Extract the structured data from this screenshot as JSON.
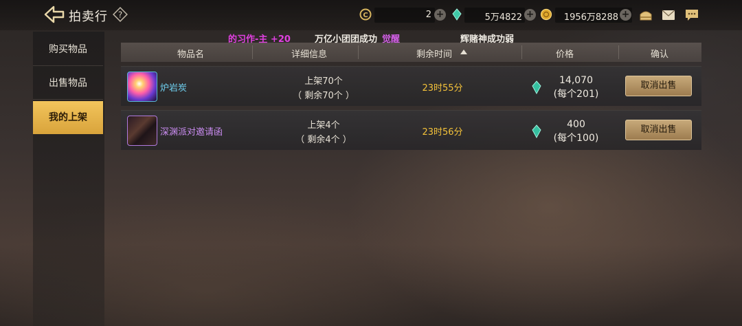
{
  "header": {
    "title": "拍卖行",
    "currencies": [
      {
        "name": "coupon",
        "value": "2"
      },
      {
        "name": "crystal",
        "value": "5万4822"
      },
      {
        "name": "gold",
        "value": "1956万8288"
      }
    ]
  },
  "marquee": {
    "part1": "的习作-主 +20",
    "part2a": "万亿小团团成功",
    "part2b": "觉醒",
    "part3": "辉赌神成功弱"
  },
  "sidebar": {
    "items": [
      {
        "label": "购买物品"
      },
      {
        "label": "出售物品"
      },
      {
        "label": "我的上架"
      }
    ]
  },
  "table": {
    "headers": [
      "物品名",
      "详细信息",
      "剩余时间",
      "价格",
      "确认"
    ],
    "rows": [
      {
        "name": "炉岩炭",
        "listed": "上架70个",
        "remaining": "（ 剩余70个 ）",
        "time": "23时55分",
        "price": "14,070",
        "unit_price": "(每个201)",
        "action": "取消出售"
      },
      {
        "name": "深渊派对邀请函",
        "listed": "上架4个",
        "remaining": "（ 剩余4个 ）",
        "time": "23时56分",
        "price": "400",
        "unit_price": "(每个100)",
        "action": "取消出售"
      }
    ]
  },
  "colors": {
    "accent": "#f2c55c",
    "time": "#f4c23a",
    "item_name_1": "#6fd0f0",
    "item_name_2": "#c98cf0",
    "marquee_magenta": "#e040e0"
  }
}
